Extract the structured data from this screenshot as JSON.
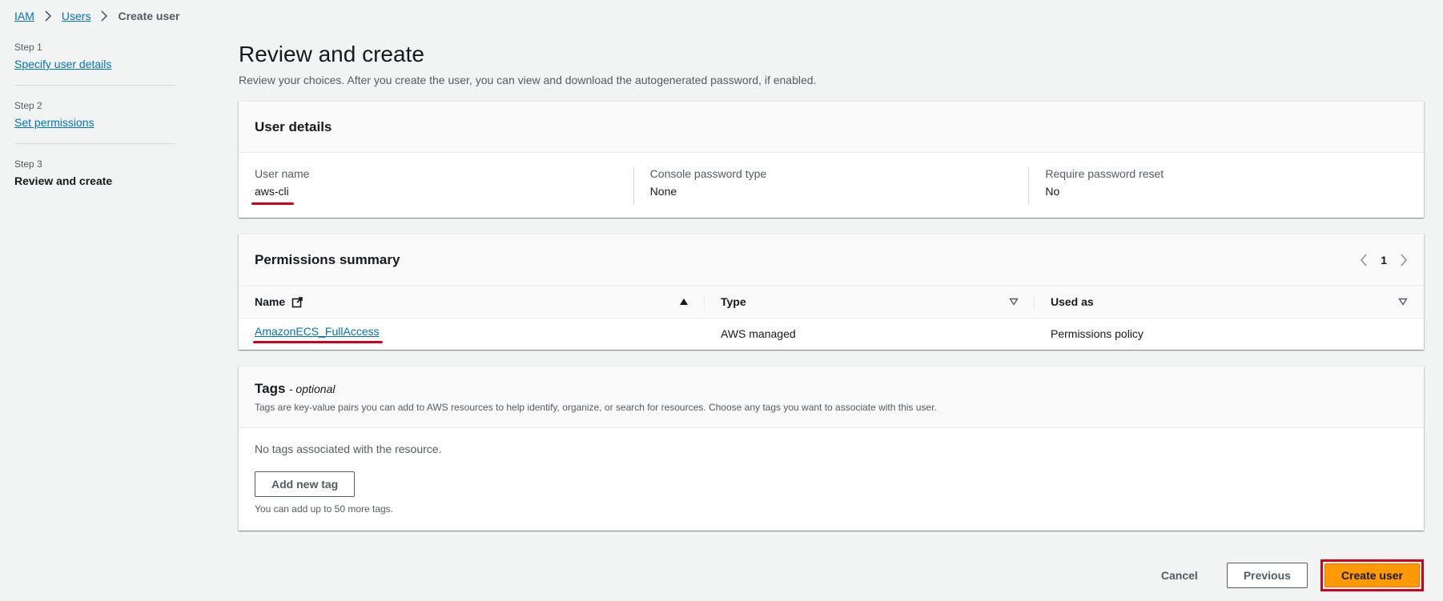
{
  "breadcrumb": {
    "items": [
      "IAM",
      "Users"
    ],
    "current": "Create user"
  },
  "steps": [
    {
      "label": "Step 1",
      "title": "Specify user details"
    },
    {
      "label": "Step 2",
      "title": "Set permissions"
    },
    {
      "label": "Step 3",
      "title": "Review and create"
    }
  ],
  "page": {
    "title": "Review and create",
    "description": "Review your choices. After you create the user, you can view and download the autogenerated password, if enabled."
  },
  "user_details": {
    "heading": "User details",
    "fields": [
      {
        "label": "User name",
        "value": "aws-cli"
      },
      {
        "label": "Console password type",
        "value": "None"
      },
      {
        "label": "Require password reset",
        "value": "No"
      }
    ]
  },
  "permissions": {
    "heading": "Permissions summary",
    "page_number": "1",
    "columns": [
      "Name",
      "Type",
      "Used as"
    ],
    "rows": [
      {
        "name": "AmazonECS_FullAccess",
        "type": "AWS managed",
        "used_as": "Permissions policy"
      }
    ]
  },
  "tags": {
    "heading": "Tags",
    "optional": "- optional",
    "description": "Tags are key-value pairs you can add to AWS resources to help identify, organize, or search for resources. Choose any tags you want to associate with this user.",
    "empty": "No tags associated with the resource.",
    "add_button": "Add new tag",
    "hint": "You can add up to 50 more tags."
  },
  "actions": {
    "cancel": "Cancel",
    "previous": "Previous",
    "create": "Create user"
  },
  "colors": {
    "link": "#0073bb",
    "primary": "#ff9900",
    "highlight": "#d0021b"
  },
  "icons": [
    "chevron-right-icon",
    "external-link-icon",
    "sort-ascending-icon",
    "sort-icon",
    "chevron-left-icon"
  ]
}
